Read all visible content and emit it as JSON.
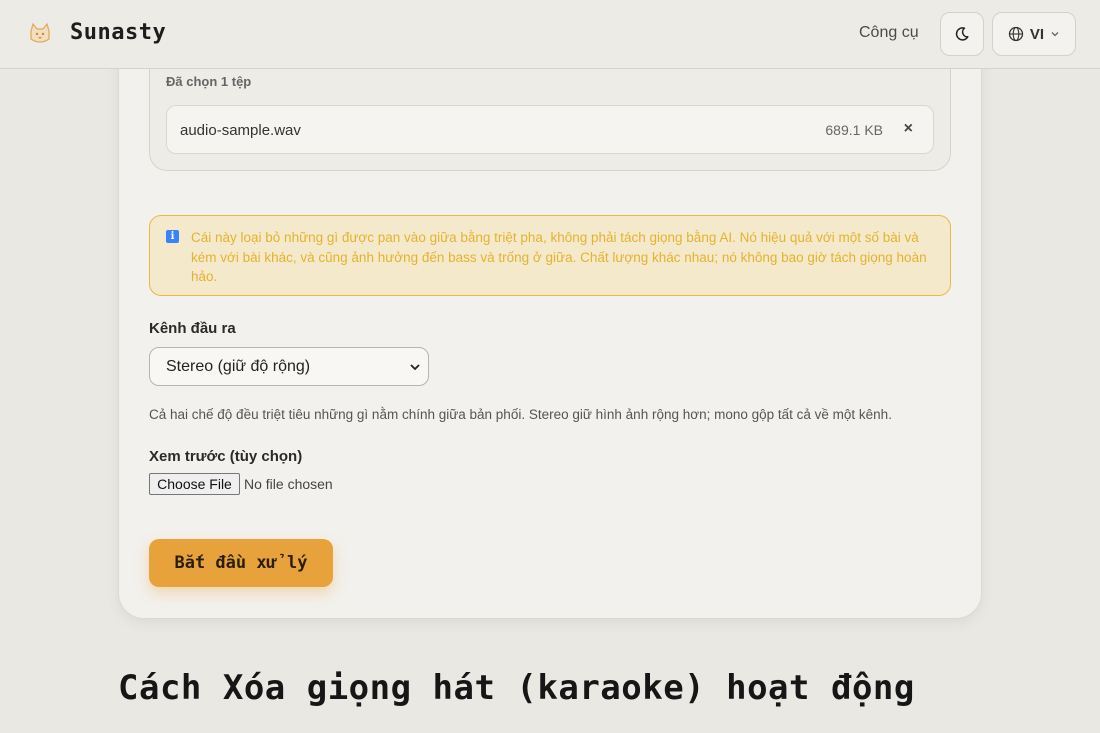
{
  "header": {
    "brand": "Sunasty",
    "tools_link": "Công cụ",
    "theme_icon": "moon-icon",
    "language_code": "VI"
  },
  "upload": {
    "selected_count": "Đã chọn 1 tệp",
    "files": [
      {
        "name": "audio-sample.wav",
        "size": "689.1 KB",
        "remove": "×"
      }
    ]
  },
  "notice": {
    "icon": "info-icon",
    "text": "Cái này loại bỏ những gì được pan vào giữa bằng triệt pha, không phải tách giọng bằng AI. Nó hiệu quả với một số bài và kém với bài khác, và cũng ảnh hưởng đến bass và trống ở giữa. Chất lượng khác nhau; nó không bao giờ tách giọng hoàn hảo."
  },
  "output_channel": {
    "label": "Kênh đầu ra",
    "selected": "Stereo (giữ độ rộng)",
    "help": "Cả hai chế độ đều triệt tiêu những gì nằm chính giữa bản phối. Stereo giữ hình ảnh rộng hơn; mono gộp tất cả về một kênh."
  },
  "preview": {
    "label": "Xem trước (tùy chọn)",
    "choose_file": "Choose File",
    "status": "No file chosen"
  },
  "actions": {
    "start": "Bắt đầu xử lý"
  },
  "section": {
    "heading": "Cách Xóa giọng hát (karaoke) hoạt động"
  },
  "colors": {
    "accent": "#e8a23c",
    "notice_border": "#e8b84a",
    "notice_text": "#e3b32f",
    "background": "#eae8e3"
  }
}
